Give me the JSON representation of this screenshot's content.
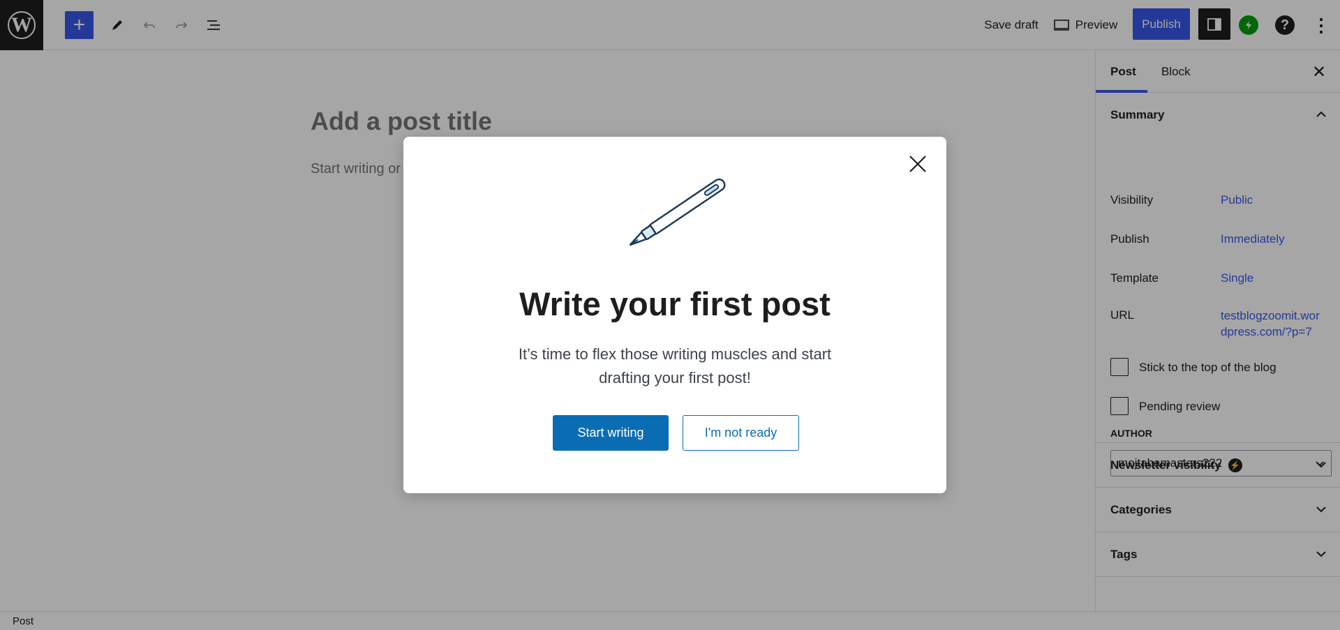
{
  "toolbar": {
    "logo_icon": "wordpress-logo-icon",
    "inserter_glyph": "+",
    "save_draft_label": "Save draft",
    "preview_label": "Preview",
    "publish_label": "Publish",
    "options_glyph": "⋮",
    "help_glyph": "?"
  },
  "editor": {
    "title_placeholder": "Add a post title",
    "body_placeholder": "Start writing or"
  },
  "sidebar": {
    "tabs": [
      {
        "label": "Post"
      },
      {
        "label": "Block"
      }
    ],
    "close_glyph": "✕",
    "summary": {
      "title": "Summary",
      "rows": [
        {
          "label": "Visibility",
          "value": "Public"
        },
        {
          "label": "Publish",
          "value": "Immediately"
        },
        {
          "label": "Template",
          "value": "Single"
        },
        {
          "label": "URL",
          "value": "testblogzoomit.wordpress.com/?p=7"
        }
      ],
      "checkboxes": [
        {
          "label": "Stick to the top of the blog",
          "checked": false
        },
        {
          "label": "Pending review",
          "checked": false
        }
      ],
      "author_label": "AUTHOR",
      "author_value": "mojtabamasters222"
    },
    "panels": [
      {
        "title": "Newsletter visibility"
      },
      {
        "title": "Categories"
      },
      {
        "title": "Tags"
      }
    ]
  },
  "statusbar": {
    "label": "Post"
  },
  "modal": {
    "title": "Write your first post",
    "text": "It’s time to flex those writing muscles and start drafting your first post!",
    "primary_button": "Start writing",
    "secondary_button": "I'm not ready"
  },
  "colors": {
    "accent": "#3858e9",
    "modal_button": "#0a6db3",
    "jetpack": "#069e08"
  }
}
